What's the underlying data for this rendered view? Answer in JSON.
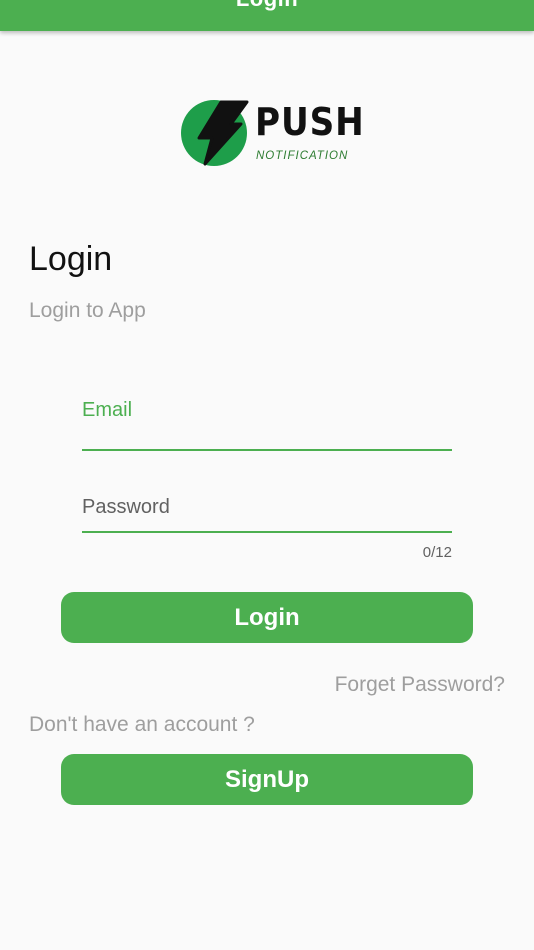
{
  "app_bar": {
    "title": "Login",
    "color": "#4caf50"
  },
  "logo": {
    "icon": "lightning-bolt-icon",
    "title": "PUSH",
    "subtitle": "NOTIFICATION",
    "circle_color": "#1e9e4a"
  },
  "page": {
    "heading": "Login",
    "subheading": "Login to App"
  },
  "form": {
    "email": {
      "label": "Email",
      "value": ""
    },
    "password": {
      "label": "Password",
      "value": "",
      "counter": "0/12"
    }
  },
  "actions": {
    "login_label": "Login",
    "forget_password": "Forget Password?",
    "no_account": "Don't have an account ?",
    "signup_label": "SignUp"
  },
  "colors": {
    "accent": "#4caf50",
    "muted_text": "#9e9e9e",
    "background": "#fafafa"
  }
}
